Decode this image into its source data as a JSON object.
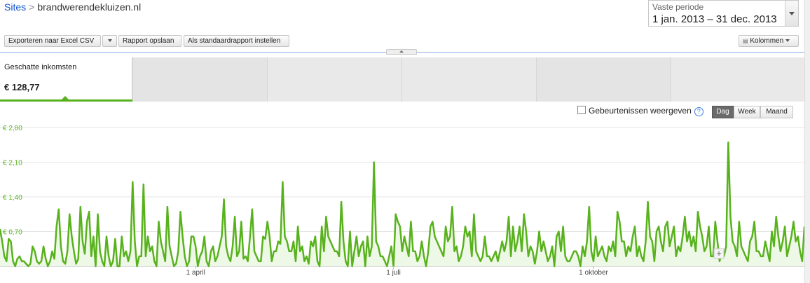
{
  "breadcrumb": {
    "root": "Sites",
    "separator": ">",
    "site": "brandwerendekluizen.nl"
  },
  "period": {
    "label": "Vaste periode",
    "value": "1 jan. 2013 – 31 dec. 2013"
  },
  "toolbar": {
    "export_label": "Exporteren naar Excel CSV",
    "save_label": "Rapport opslaan",
    "default_label": "Als standaardrapport instellen",
    "columns_label": "Kolommen"
  },
  "metric": {
    "name": "Geschatte inkomsten",
    "value": "€ 128,77"
  },
  "events": {
    "label": "Gebeurtenissen weergeven",
    "help": "?"
  },
  "granularity": {
    "options": [
      "Dag",
      "Week",
      "Maand"
    ],
    "selected": "Dag"
  },
  "colors": {
    "series": "#58b21d",
    "fill": "#eef8e6",
    "axis_label": "#58b21d"
  },
  "chart_data": {
    "type": "area",
    "x_start": "2013-01-01",
    "x_end": "2013-12-31",
    "ylim": [
      0,
      2.8
    ],
    "yticks": [
      "€ 2,80",
      "€ 2,10",
      "€ 1,40",
      "€ 0,70"
    ],
    "xticks": [
      "1 april",
      "1 juli",
      "1 oktober"
    ],
    "series": [
      {
        "values": [
          0.75,
          0.5,
          0.2,
          0.1,
          0.55,
          0.5,
          0.1,
          0,
          0.15,
          0.2,
          0.1,
          0.1,
          0.05,
          0,
          0.05,
          0.4,
          0.3,
          0.1,
          0.05,
          0.1,
          0.4,
          0.15,
          0,
          0.1,
          0.3,
          0.15,
          0.8,
          1.15,
          0.4,
          0.1,
          0.05,
          0.3,
          1.05,
          0.6,
          0.3,
          0.05,
          0.15,
          1.2,
          0.5,
          0.25,
          0.9,
          1.1,
          0.2,
          0.6,
          0,
          1.05,
          0.3,
          0.1,
          0,
          0.6,
          0.2,
          0,
          0.1,
          0.55,
          0,
          0,
          0.6,
          0.2,
          0.3,
          0.1,
          0.3,
          1.7,
          0.5,
          0,
          0.2,
          0.2,
          1.65,
          0.2,
          0.6,
          0.3,
          0.4,
          0.1,
          0,
          0.9,
          0.5,
          0.3,
          0.1,
          1.2,
          0.4,
          0.2,
          0,
          0.05,
          0.3,
          1.1,
          0.6,
          0.2,
          0,
          0.1,
          0.6,
          0.6,
          0.4,
          0,
          0.2,
          0.3,
          0.6,
          0.1,
          0,
          0.3,
          0.4,
          0.1,
          0.2,
          0.4,
          0.6,
          1.35,
          0.4,
          0.2,
          0.1,
          0.4,
          1.0,
          0.2,
          0.3,
          0.9,
          0.15,
          0.2,
          0.1,
          0.6,
          1.15,
          0.3,
          0.2,
          0.1,
          0.1,
          0.6,
          0.55,
          0.9,
          0.6,
          0.1,
          0.3,
          0.3,
          0.5,
          0.45,
          1.7,
          0.6,
          0.5,
          0.3,
          0.3,
          0.5,
          0.1,
          0.8,
          0.3,
          0.4,
          0.1,
          0.2,
          0.05,
          0.5,
          0.4,
          0.6,
          0.1,
          0,
          0.8,
          0.3,
          1.0,
          0.6,
          0.5,
          0.4,
          0.3,
          0.3,
          0.2,
          1.3,
          0.5,
          0.1,
          0,
          0.7,
          0,
          0.3,
          0.6,
          0.2,
          0.4,
          0.5,
          0,
          0.6,
          0.2,
          0.4,
          2.1,
          0.5,
          0.4,
          0.2,
          0.2,
          0.1,
          0,
          0.2,
          0.4,
          0,
          1.05,
          0.9,
          0.8,
          0.3,
          0.6,
          0.4,
          0.2,
          0.9,
          0.3,
          0.3,
          0.1,
          0.2,
          0.5,
          0.2,
          0,
          0.3,
          0.8,
          0.9,
          0.6,
          0.5,
          0.4,
          0.3,
          0.2,
          0.8,
          0.5,
          0.6,
          1.2,
          0.3,
          0.4,
          0.1,
          0.2,
          0.4,
          0.8,
          0.6,
          0.7,
          0.2,
          1.05,
          0.3,
          0.2,
          0.1,
          0.2,
          0.6,
          0.2,
          0.2,
          0.1,
          0.2,
          0.3,
          0.1,
          0.3,
          0.5,
          0.3,
          0.5,
          1.0,
          0.2,
          0.8,
          0.3,
          0.5,
          0.8,
          0.3,
          1.05,
          0.7,
          0.2,
          0.4,
          0.3,
          0.05,
          0.3,
          0.7,
          0.3,
          0.5,
          0.3,
          0.1,
          0.2,
          0.4,
          0,
          0.6,
          0.7,
          0.3,
          0.8,
          0.2,
          0.1,
          0.1,
          0.2,
          0.3,
          0.3,
          0.2,
          0,
          0.4,
          0.2,
          0.5,
          1.2,
          0.3,
          0.1,
          0.6,
          0.2,
          0.3,
          0.4,
          0.2,
          0.1,
          0.4,
          0.3,
          0.5,
          0.2,
          1.1,
          0.9,
          0.5,
          0.5,
          0.2,
          0.4,
          0.3,
          0.6,
          0.8,
          0.2,
          0.4,
          0.2,
          0.1,
          0.5,
          1.3,
          0.6,
          0.5,
          0.1,
          0.7,
          0.8,
          0.5,
          0.3,
          0.8,
          0.9,
          0.4,
          0.6,
          0.8,
          0.2,
          0.4,
          0.3,
          0.6,
          1.0,
          0.5,
          0.7,
          0.4,
          0.6,
          0.3,
          1.1,
          0.8,
          0.6,
          0.3,
          0.4,
          0.8,
          0.2,
          0.2,
          0.9,
          0.5,
          0.1,
          0.3,
          0.2,
          0.4,
          2.5,
          1.0,
          0.5,
          0.4,
          0.2,
          0.9,
          0.4,
          0.3,
          0.2,
          0.1,
          0.5,
          0.6,
          0.9,
          0.3,
          0.3,
          0.2,
          0.2,
          0.5,
          0.3,
          0.1,
          0.7,
          0.4,
          1.0,
          0.6,
          0.3,
          0.5,
          0.8,
          0.2,
          0.4,
          0.6,
          0.9,
          0.5,
          0.6,
          0.3,
          0.1,
          0.8
        ]
      }
    ]
  }
}
